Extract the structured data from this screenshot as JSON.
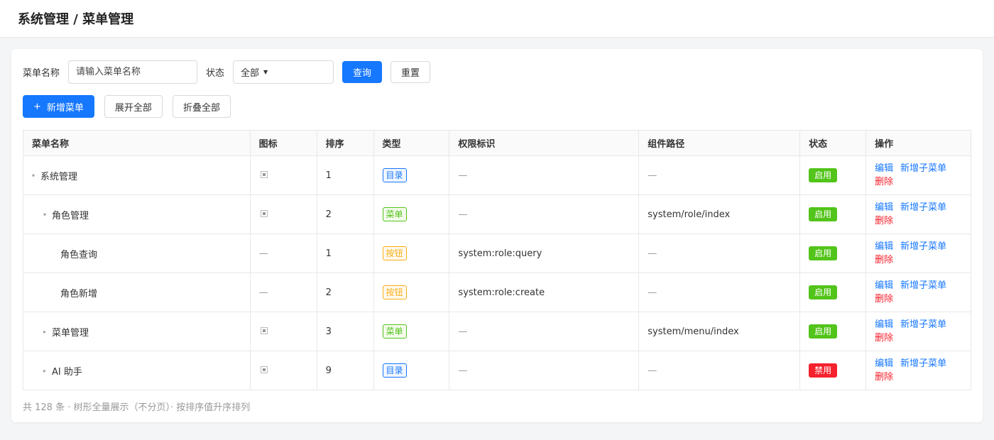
{
  "header": {
    "title": "系统管理 / 菜单管理"
  },
  "filters": {
    "name_label": "菜单名称",
    "name_placeholder": "请输入菜单名称",
    "status_label": "状态",
    "status_value": "全部",
    "query_button": "查询",
    "reset_button": "重置"
  },
  "actions": {
    "add_label": "新增菜单",
    "expand_label": "展开全部",
    "collapse_label": "折叠全部"
  },
  "table": {
    "columns": [
      "菜单名称",
      "图标",
      "排序",
      "类型",
      "权限标识",
      "组件路径",
      "状态",
      "操作"
    ],
    "rows": [
      {
        "name": "系统管理",
        "caret": "▾",
        "has_icon": true,
        "sort": "1",
        "type": "目录",
        "perm": "—",
        "path": "—",
        "status": "启用"
      },
      {
        "name": "角色管理",
        "caret": "▾",
        "has_icon": true,
        "sort": "2",
        "type": "菜单",
        "perm": "—",
        "path": "system/role/index",
        "status": "启用"
      },
      {
        "name": "角色查询",
        "caret": "",
        "has_icon": false,
        "sort": "1",
        "type": "按钮",
        "perm": "system:role:query",
        "path": "—",
        "status": "启用"
      },
      {
        "name": "角色新增",
        "caret": "",
        "has_icon": false,
        "sort": "2",
        "type": "按钮",
        "perm": "system:role:create",
        "path": "—",
        "status": "启用"
      },
      {
        "name": "菜单管理",
        "caret": "▸",
        "has_icon": true,
        "sort": "3",
        "type": "菜单",
        "perm": "—",
        "path": "system/menu/index",
        "status": "启用"
      },
      {
        "name": "AI 助手",
        "caret": "▸",
        "has_icon": true,
        "sort": "9",
        "type": "目录",
        "perm": "—",
        "path": "—",
        "status": "禁用"
      }
    ],
    "ops": {
      "edit": "编辑",
      "add_child": "新增子菜单",
      "delete": "删除"
    }
  },
  "footer": {
    "summary": "共 128 条 · 树形全量展示（不分页）· 按排序值升序排列"
  },
  "colors": {
    "primary": "#1677ff",
    "success": "#52c41a",
    "warning": "#faad14",
    "danger": "#f5222d"
  }
}
